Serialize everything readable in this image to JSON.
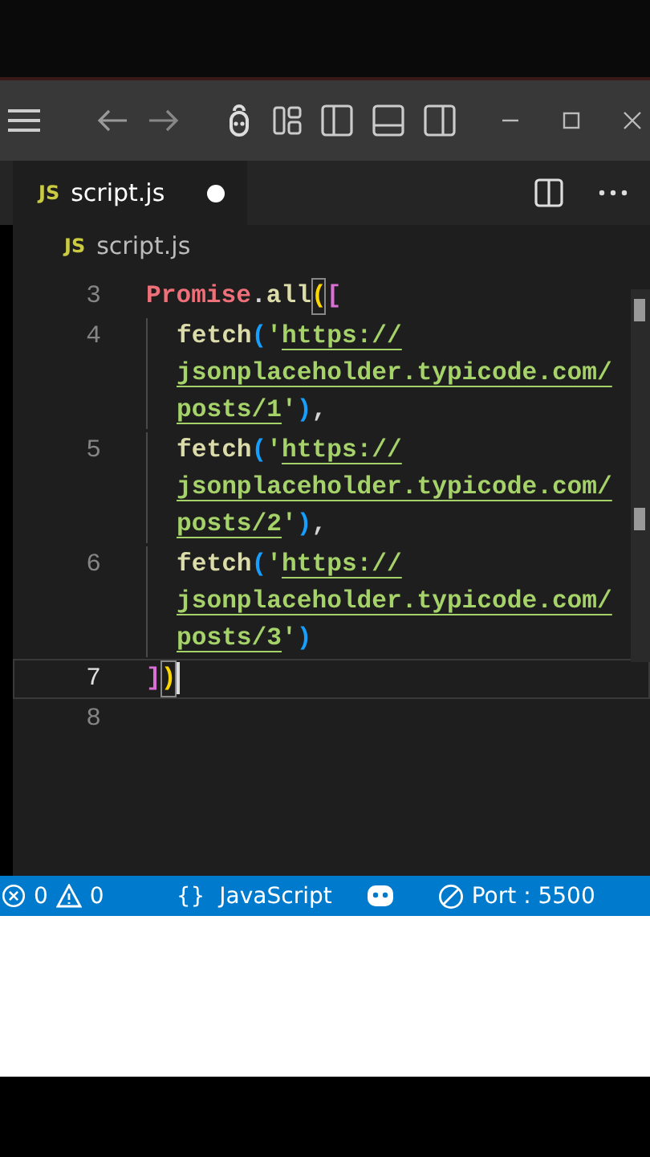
{
  "tab": {
    "icon_label": "JS",
    "label": "script.js",
    "modified": true,
    "selected": true
  },
  "breadcrumb": {
    "icon_label": "JS",
    "label": "script.js"
  },
  "lines": [
    {
      "number": "3",
      "current": false,
      "rows": [
        {
          "indent": false,
          "tokens": [
            {
              "text": "Promise",
              "kind": "class"
            },
            {
              "text": ".",
              "kind": "punct"
            },
            {
              "text": "all",
              "kind": "func"
            },
            {
              "text": "(",
              "kind": "bracket1",
              "highlighted": true
            },
            {
              "text": "[",
              "kind": "bracket2",
              "highlighted": false
            }
          ]
        }
      ]
    },
    {
      "number": "4",
      "current": false,
      "rows": [
        {
          "indent": true,
          "tokens": [
            {
              "text": "fetch",
              "kind": "func"
            },
            {
              "text": "(",
              "kind": "bracket3",
              "highlighted": false
            },
            {
              "text": "'",
              "kind": "string"
            },
            {
              "text": "https://",
              "kind": "link"
            }
          ]
        },
        {
          "indent": true,
          "tokens": [
            {
              "text": "jsonplaceholder.typicode.com/",
              "kind": "link"
            }
          ]
        },
        {
          "indent": true,
          "tokens": [
            {
              "text": "posts/1",
              "kind": "link"
            },
            {
              "text": "'",
              "kind": "string"
            },
            {
              "text": ")",
              "kind": "bracket3",
              "highlighted": false
            },
            {
              "text": ",",
              "kind": "punct"
            }
          ]
        }
      ]
    },
    {
      "number": "5",
      "current": false,
      "rows": [
        {
          "indent": true,
          "tokens": [
            {
              "text": "fetch",
              "kind": "func"
            },
            {
              "text": "(",
              "kind": "bracket3",
              "highlighted": false
            },
            {
              "text": "'",
              "kind": "string"
            },
            {
              "text": "https://",
              "kind": "link"
            }
          ]
        },
        {
          "indent": true,
          "tokens": [
            {
              "text": "jsonplaceholder.typicode.com/",
              "kind": "link"
            }
          ]
        },
        {
          "indent": true,
          "tokens": [
            {
              "text": "posts/2",
              "kind": "link"
            },
            {
              "text": "'",
              "kind": "string"
            },
            {
              "text": ")",
              "kind": "bracket3",
              "highlighted": false
            },
            {
              "text": ",",
              "kind": "punct"
            }
          ]
        }
      ]
    },
    {
      "number": "6",
      "current": false,
      "rows": [
        {
          "indent": true,
          "tokens": [
            {
              "text": "fetch",
              "kind": "func"
            },
            {
              "text": "(",
              "kind": "bracket3",
              "highlighted": false
            },
            {
              "text": "'",
              "kind": "string"
            },
            {
              "text": "https://",
              "kind": "link"
            }
          ]
        },
        {
          "indent": true,
          "tokens": [
            {
              "text": "jsonplaceholder.typicode.com/",
              "kind": "link"
            }
          ]
        },
        {
          "indent": true,
          "tokens": [
            {
              "text": "posts/3",
              "kind": "link"
            },
            {
              "text": "'",
              "kind": "string"
            },
            {
              "text": ")",
              "kind": "bracket3",
              "highlighted": false
            }
          ]
        }
      ]
    },
    {
      "number": "7",
      "current": true,
      "rows": [
        {
          "indent": false,
          "tokens": [
            {
              "text": "]",
              "kind": "bracket2",
              "highlighted": false
            },
            {
              "text": ")",
              "kind": "bracket1",
              "highlighted": true
            }
          ]
        }
      ]
    },
    {
      "number": "8",
      "current": false,
      "rows": [
        {
          "tokens": []
        }
      ]
    }
  ],
  "status_bar": {
    "errors": "0",
    "warnings": "0",
    "language_icon": "{}",
    "language": "JavaScript",
    "port": "Port : 5500"
  }
}
